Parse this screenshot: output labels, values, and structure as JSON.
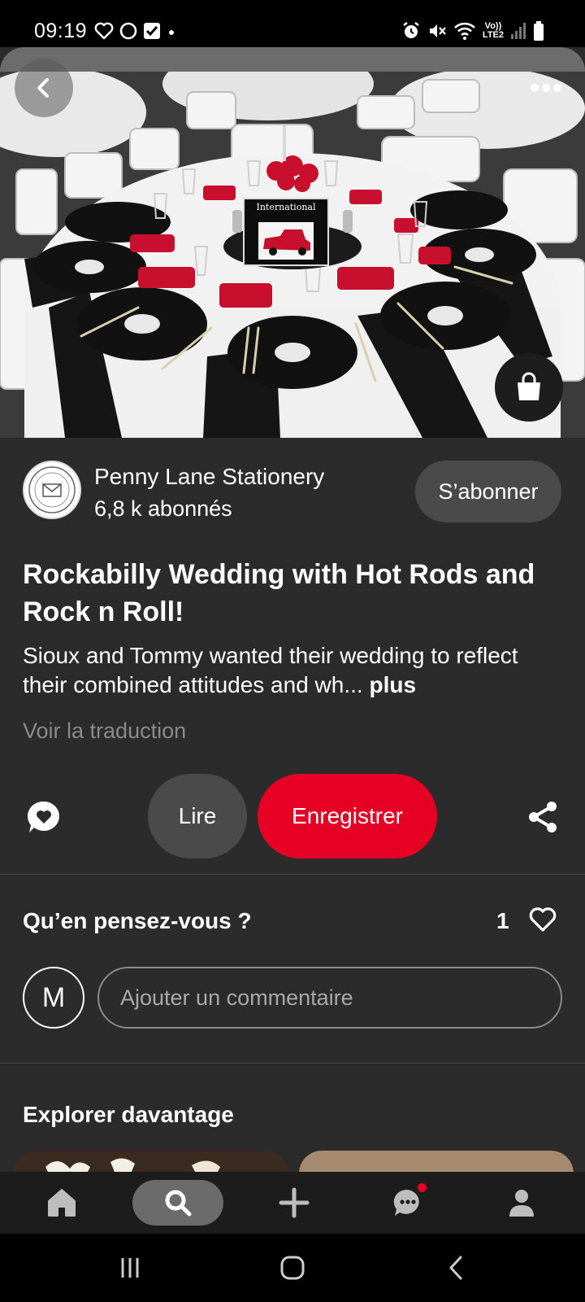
{
  "status_bar": {
    "time": "09:19",
    "network_label_top": "Vo))",
    "network_label_bottom": "LTE2"
  },
  "hero": {
    "sign_text": "International",
    "colors": {
      "napkin": "#d11a2a",
      "tablecloth": "#f2f2f2",
      "vinyl": "#111111"
    }
  },
  "creator": {
    "name": "Penny Lane Stationery",
    "followers": "6,8 k abonnés",
    "follow_label": "S’abonner"
  },
  "pin": {
    "title": "Rockabilly Wedding with Hot Rods and Rock n Roll!",
    "description": "Sioux and Tommy wanted their wedding to reflect their combined attitudes and wh...",
    "more_label": "plus",
    "translate_label": "Voir la traduction"
  },
  "actions": {
    "read_label": "Lire",
    "save_label": "Enregistrer"
  },
  "comments": {
    "heading": "Qu’en pensez-vous ?",
    "like_count": "1",
    "user_initial": "M",
    "input_placeholder": "Ajouter un commentaire"
  },
  "explore": {
    "heading": "Explorer davantage"
  },
  "colors": {
    "accent": "#e60023",
    "background": "#2b2b2b",
    "secondary_button": "#4a4a4a"
  },
  "icons": {
    "back": "chevron-left-icon",
    "more": "more-horizontal-icon",
    "bag": "shopping-bag-icon",
    "react": "heart-bubble-icon",
    "share": "share-icon",
    "like": "heart-outline-icon",
    "nav": [
      "home-icon",
      "search-icon",
      "plus-icon",
      "chat-bubble-icon",
      "person-icon"
    ]
  }
}
